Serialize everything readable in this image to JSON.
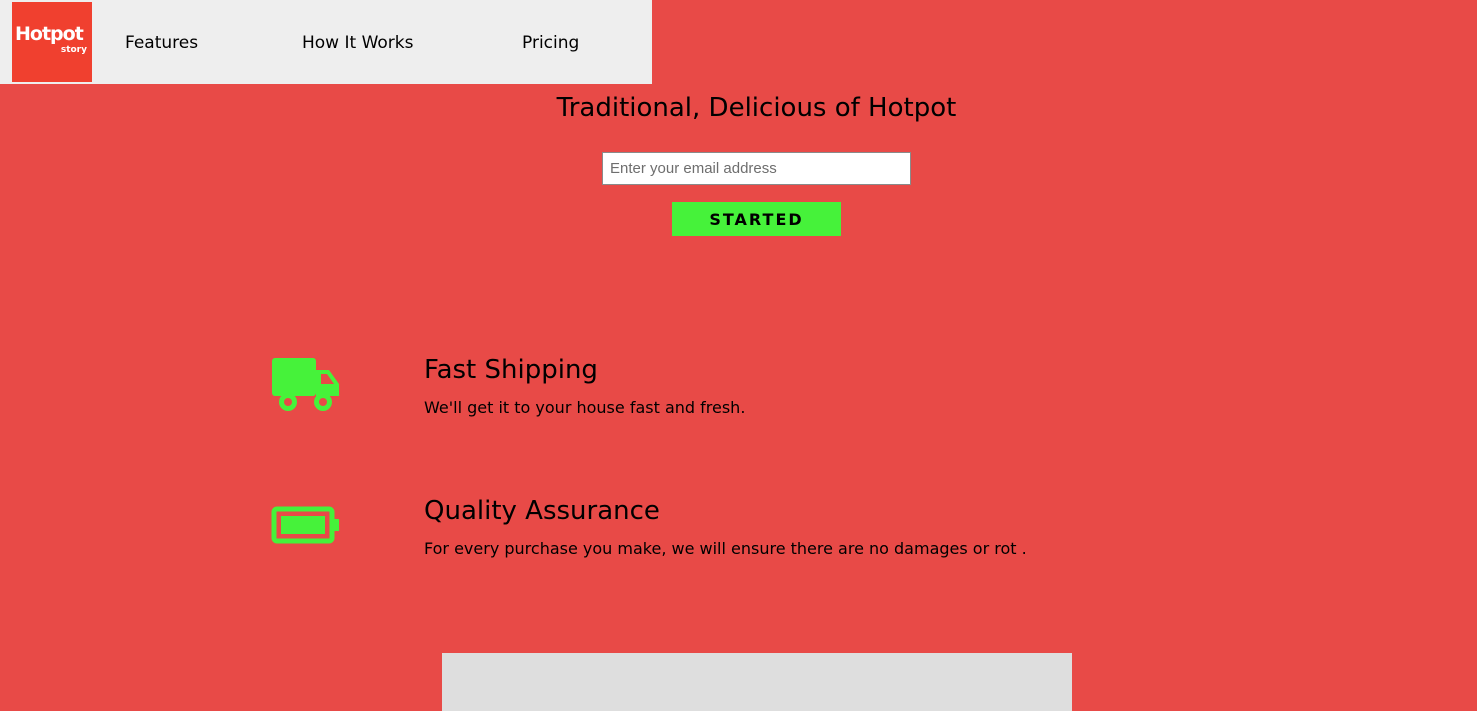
{
  "nav": {
    "logo": {
      "main": "Hotpot",
      "sub": "story"
    },
    "links": [
      "Features",
      "How It Works",
      "Pricing"
    ]
  },
  "hero": {
    "title": "Traditional, Delicious of Hotpot",
    "email_placeholder": "Enter your email address",
    "button_label": "STARTED"
  },
  "features": [
    {
      "icon": "truck-icon",
      "title": "Fast Shipping",
      "desc": "We'll get it to your house fast and fresh."
    },
    {
      "icon": "battery-icon",
      "title": "Quality Assurance",
      "desc": "For every purchase you make, we will ensure there are no damages or rot ."
    }
  ],
  "colors": {
    "background": "#e84a47",
    "navbar": "#eeeeee",
    "accent": "#46f23a",
    "logo_bg": "#f0402f"
  }
}
